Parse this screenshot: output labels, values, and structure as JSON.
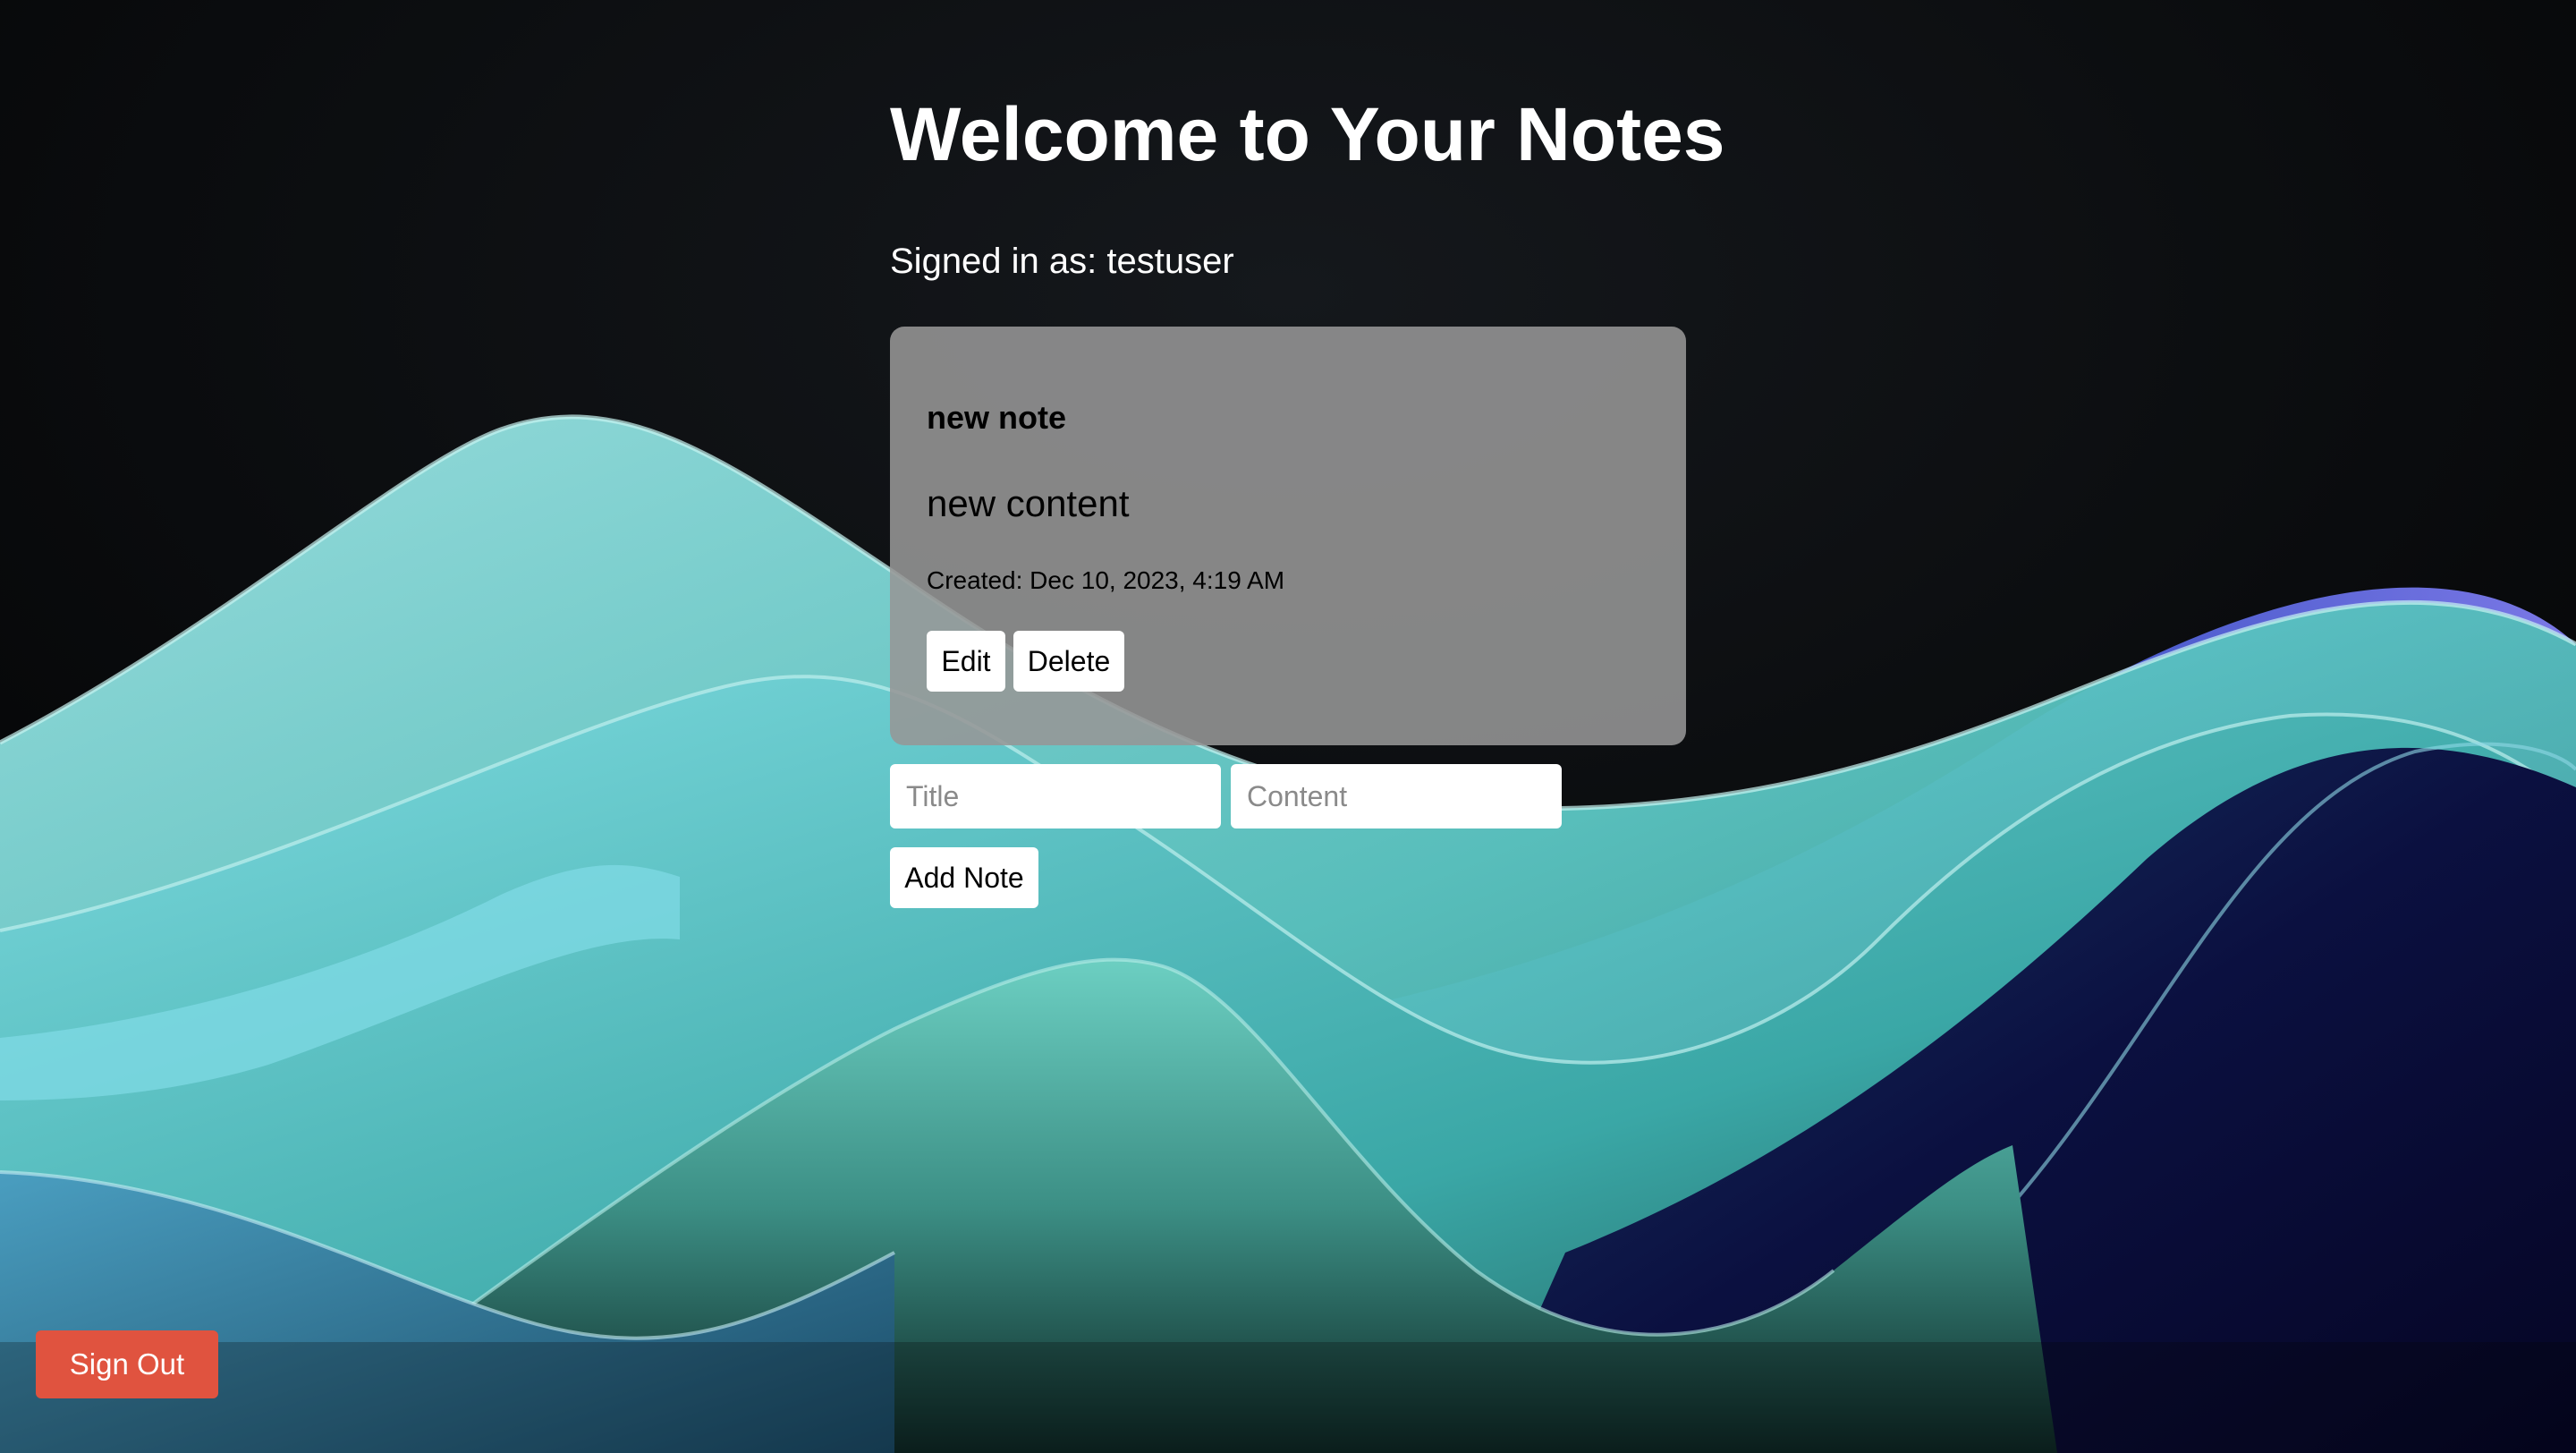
{
  "page": {
    "title": "Welcome to Your Notes",
    "signed_in": "Signed in as: testuser"
  },
  "notes": [
    {
      "title": "new note",
      "content": "new content",
      "created": "Created: Dec 10, 2023, 4:19 AM",
      "edit_label": "Edit",
      "delete_label": "Delete"
    }
  ],
  "form": {
    "title_placeholder": "Title",
    "content_placeholder": "Content",
    "title_value": "",
    "content_value": "",
    "add_label": "Add Note"
  },
  "auth": {
    "sign_out_label": "Sign Out"
  },
  "colors": {
    "background": "#050607",
    "sign_out": "#e0533f",
    "card": "#969696",
    "wave_teal": "#5fd3c8",
    "wave_blue": "#3a55c8"
  }
}
